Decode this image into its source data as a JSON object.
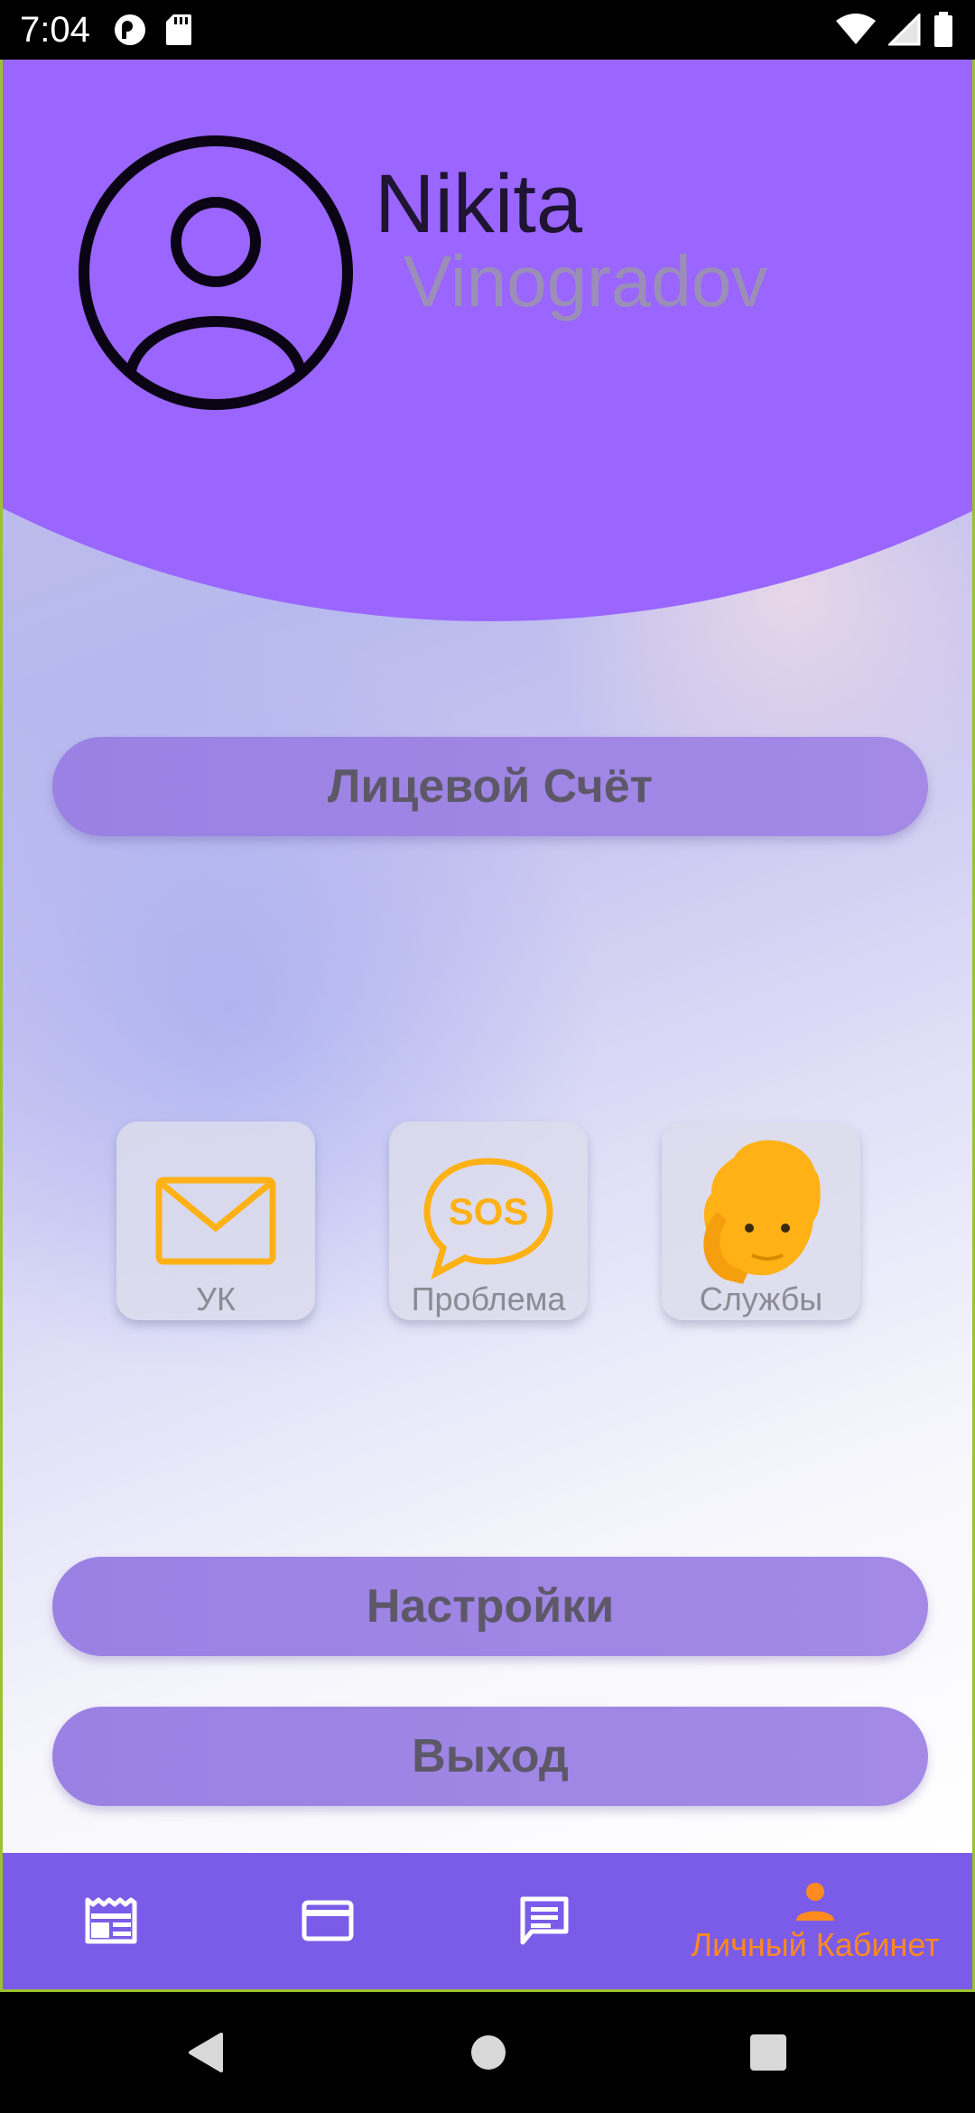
{
  "status_bar": {
    "time": "7:04"
  },
  "profile": {
    "first_name": "Nikita",
    "last_name": "Vinogradov"
  },
  "buttons": {
    "account": "Лицевой Счёт",
    "settings": "Настройки",
    "exit": "Выход"
  },
  "tiles": [
    {
      "label": "УК",
      "icon": "envelope-icon"
    },
    {
      "label": "Проблема",
      "icon": "sos-icon"
    },
    {
      "label": "Службы",
      "icon": "operator-icon"
    }
  ],
  "bottom_nav": {
    "items": [
      {
        "icon": "newspaper-icon",
        "label": ""
      },
      {
        "icon": "credit-card-icon",
        "label": ""
      },
      {
        "icon": "message-icon",
        "label": ""
      },
      {
        "icon": "person-icon",
        "label": "Личный Кабинет"
      }
    ],
    "active_index": 3
  },
  "colors": {
    "accent": "#9a66ff",
    "nav_background": "#7b5ce8",
    "active_nav": "#ff8a1e",
    "tile_icon": "#ffb116"
  }
}
